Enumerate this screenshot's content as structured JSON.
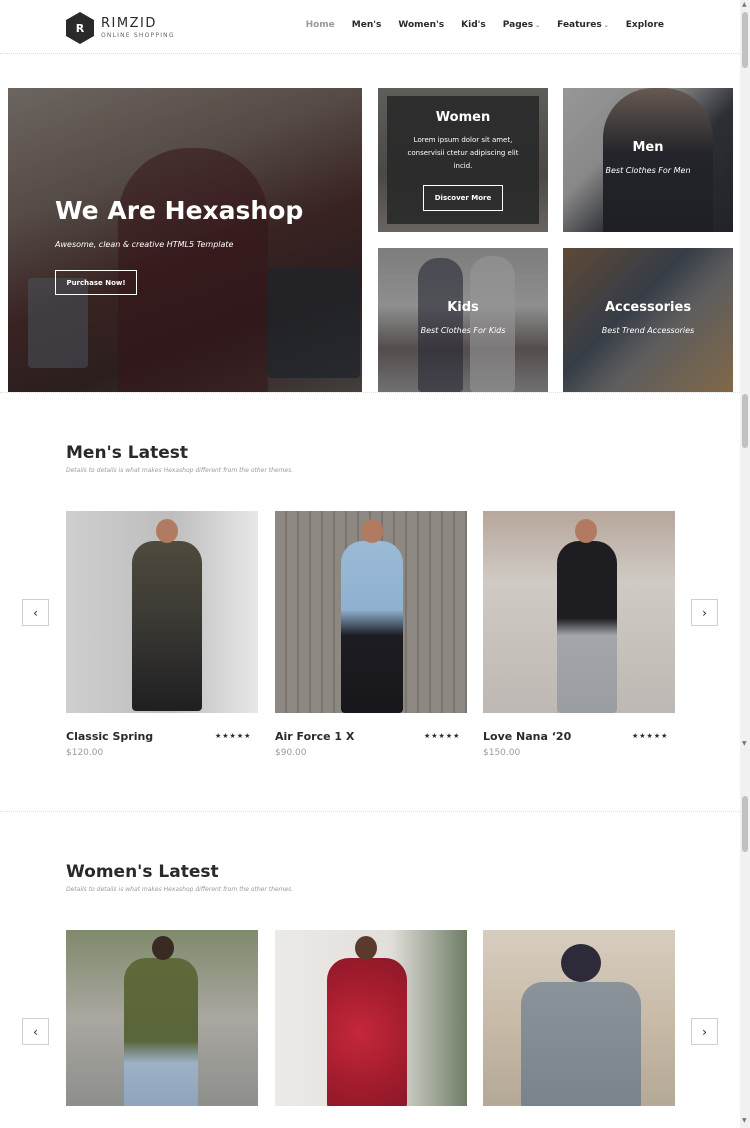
{
  "brand": {
    "name": "RIMZID",
    "tagline": "ONLINE SHOPPING",
    "mark": "R"
  },
  "nav": {
    "home": "Home",
    "mens": "Men's",
    "womens": "Women's",
    "kids": "Kid's",
    "pages": "Pages",
    "features": "Features",
    "explore": "Explore"
  },
  "hero": {
    "title": "We Are Hexashop",
    "subtitle": "Awesome, clean & creative HTML5 Template",
    "button": "Purchase Now!"
  },
  "categories": {
    "women": {
      "title": "Women",
      "description": "Lorem ipsum dolor sit amet, conservisii ctetur adipiscing elit incid.",
      "button": "Discover More"
    },
    "men": {
      "title": "Men",
      "subtitle": "Best Clothes For Men"
    },
    "kids": {
      "title": "Kids",
      "subtitle": "Best Clothes For Kids"
    },
    "accessories": {
      "title": "Accessories",
      "subtitle": "Best Trend Accessories"
    }
  },
  "mens_latest": {
    "title": "Men's Latest",
    "subtitle": "Details to details is what makes Hexashop different from the other themes.",
    "products": [
      {
        "name": "Classic Spring",
        "price": "$120.00",
        "stars": "★★★★★",
        "rating": 5
      },
      {
        "name": "Air Force 1 X",
        "price": "$90.00",
        "stars": "★★★★★",
        "rating": 5
      },
      {
        "name": "Love Nana ‘20",
        "price": "$150.00",
        "stars": "★★★★★",
        "rating": 5
      }
    ]
  },
  "womens_latest": {
    "title": "Women's Latest",
    "subtitle": "Details to details is what makes Hexashop different from the other themes."
  },
  "icons": {
    "prev": "‹",
    "next": "›",
    "caret": "⌄"
  }
}
